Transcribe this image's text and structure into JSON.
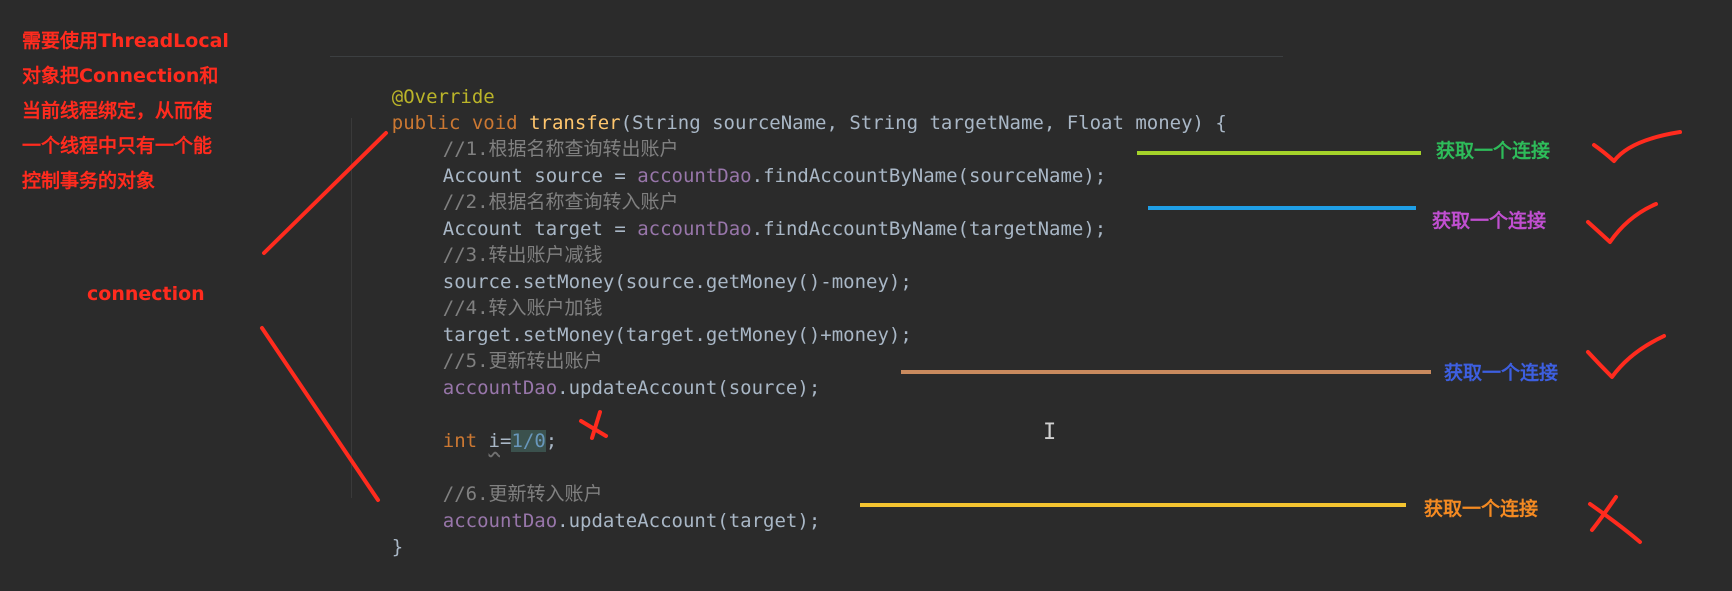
{
  "notes": {
    "left_lines": [
      "需要使用ThreadLocal",
      "对象把Connection和",
      "当前线程绑定，从而使",
      "一个线程中只有一个能",
      "控制事务的对象"
    ],
    "connection_label": "connection"
  },
  "code": {
    "annotation": "@Override",
    "sig_public": "public",
    "sig_void": "void",
    "sig_method": "transfer",
    "sig_params": "(String sourceName, String targetName, Float money) {",
    "comment1": "//1.根据名称查询转出账户",
    "l_source_type": "Account source = ",
    "l_source_dao": "accountDao",
    "l_source_call": ".findAccountByName(sourceName);",
    "comment2": "//2.根据名称查询转入账户",
    "l_target_type": "Account target = ",
    "l_target_dao": "accountDao",
    "l_target_call": ".findAccountByName(targetName);",
    "comment3": "//3.转出账户减钱",
    "l_setmoney_source": "source.setMoney(source.getMoney()-money);",
    "comment4": "//4.转入账户加钱",
    "l_setmoney_target": "target.setMoney(target.getMoney()+money);",
    "comment5": "//5.更新转出账户",
    "l_update_source_dao": "accountDao",
    "l_update_source_call": ".updateAccount(source);",
    "l_int_kw": "int ",
    "l_int_var": "i",
    "l_int_eq": "=",
    "l_int_expr": "1/0",
    "l_int_semi": ";",
    "comment6": "//6.更新转入账户",
    "l_update_target_dao": "accountDao",
    "l_update_target_call": ".updateAccount(target);",
    "close_brace": "}"
  },
  "annotations": {
    "label1": "获取一个连接",
    "label2": "获取一个连接",
    "label3": "获取一个连接",
    "label4": "获取一个连接"
  },
  "colors": {
    "annotation_red": "#ff2b1e",
    "line1": "#a4d22a",
    "label1": "#2ebc5a",
    "line2": "#1f9fe6",
    "label2": "#c04fd0",
    "line3": "#c98a5e",
    "label3": "#3d5fe0",
    "line4": "#f4c430",
    "label4": "#f48a22"
  },
  "icons": {
    "cursor": "text-cursor-icon",
    "check": "check-mark-icon",
    "cross": "cross-mark-icon"
  }
}
